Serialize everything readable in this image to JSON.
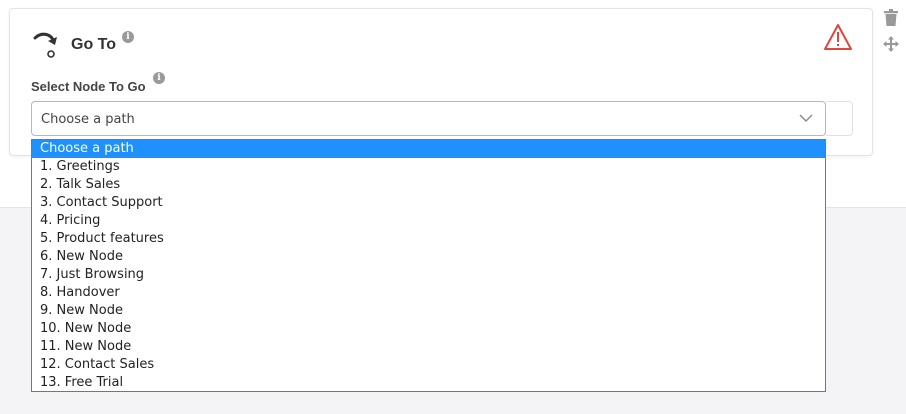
{
  "node": {
    "title": "Go To",
    "title_icon": "goto-arrow-icon",
    "info_icon_glyph": "i",
    "warning_icon": "warning-triangle-icon",
    "warning_color": "#e0473a"
  },
  "field": {
    "label": "Select Node To Go",
    "value": "Choose a path",
    "accent_color": "#b4b0ee"
  },
  "dropdown": {
    "highlight_color": "#1e90ff",
    "options": [
      "Choose a path",
      "1. Greetings",
      "2. Talk Sales",
      "3. Contact Support",
      "4. Pricing",
      "5. Product features",
      "6. New Node",
      "7. Just Browsing",
      "8. Handover",
      "9. New Node",
      "10. New Node",
      "11. New Node",
      "12. Contact Sales",
      "13. Free Trial"
    ],
    "selected_index": 0
  },
  "side_actions": {
    "delete_icon": "trash-icon",
    "move_icon": "move-arrows-icon"
  }
}
